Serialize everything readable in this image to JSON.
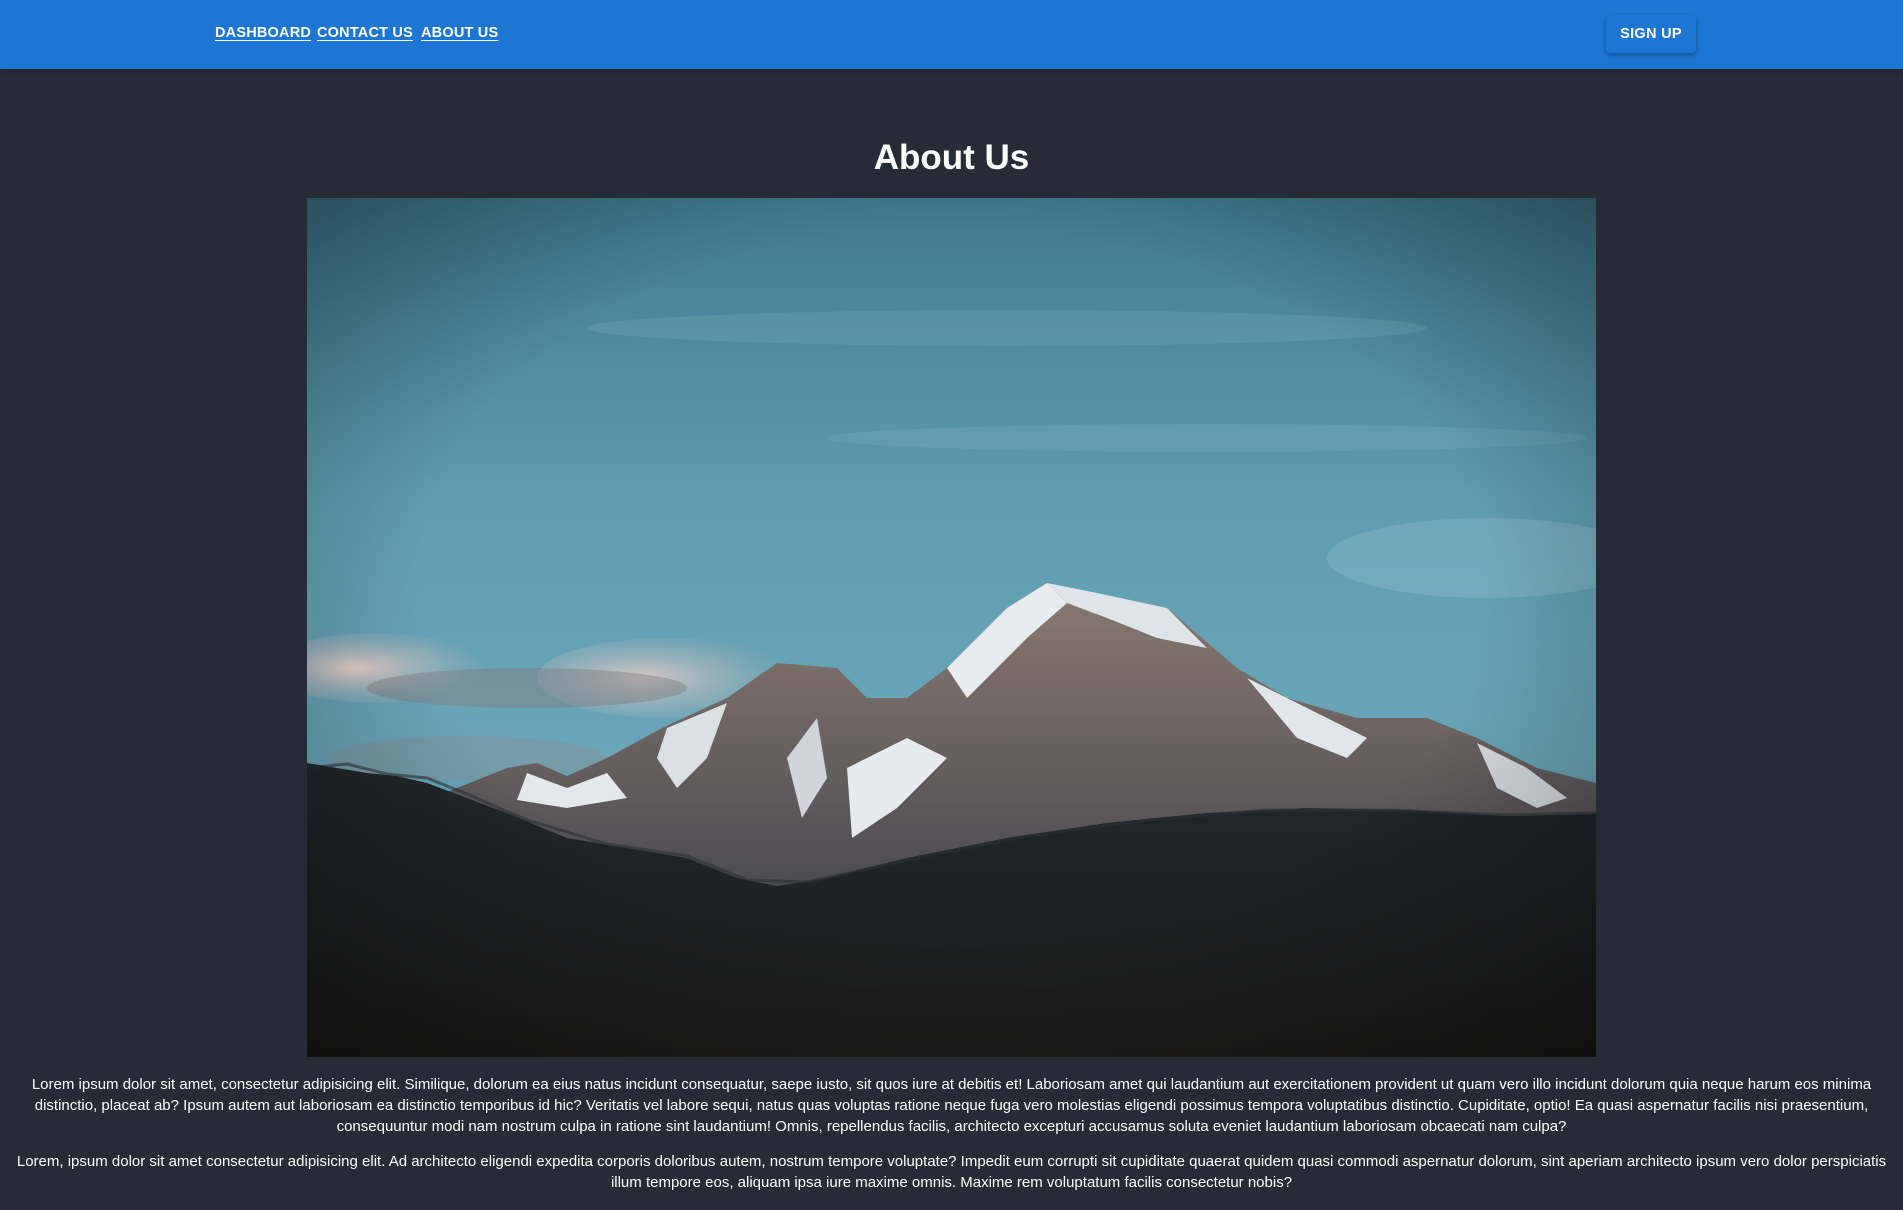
{
  "nav": {
    "links": [
      {
        "label": "DASHBOARD"
      },
      {
        "label": "CONTACT US"
      },
      {
        "label": "ABOUT US"
      }
    ],
    "signup_label": "SIGN UP"
  },
  "colors": {
    "topbar": "#1d76d2",
    "page_background": "#272b35",
    "text": "#ffffff"
  },
  "main": {
    "title": "About Us",
    "hero_image": "snowy-mountain-landscape",
    "paragraphs": [
      "Lorem ipsum dolor sit amet, consectetur adipisicing elit. Similique, dolorum ea eius natus incidunt consequatur, saepe iusto, sit quos iure at debitis et! Laboriosam amet qui laudantium aut exercitationem provident ut quam vero illo incidunt dolorum quia neque harum eos minima distinctio, placeat ab? Ipsum autem aut laboriosam ea distinctio temporibus id hic? Veritatis vel labore sequi, natus quas voluptas ratione neque fuga vero molestias eligendi possimus tempora voluptatibus distinctio. Cupiditate, optio! Ea quasi aspernatur facilis nisi praesentium, consequuntur modi nam nostrum culpa in ratione sint laudantium! Omnis, repellendus facilis, architecto excepturi accusamus soluta eveniet laudantium laboriosam obcaecati nam culpa?",
      "Lorem, ipsum dolor sit amet consectetur adipisicing elit. Ad architecto eligendi expedita corporis doloribus autem, nostrum tempore voluptate? Impedit eum corrupti sit cupiditate quaerat quidem quasi commodi aspernatur dolorum, sint aperiam architecto ipsum vero dolor perspiciatis illum tempore eos, aliquam ipsa iure maxime omnis. Maxime rem voluptatum facilis consectetur nobis?"
    ]
  }
}
